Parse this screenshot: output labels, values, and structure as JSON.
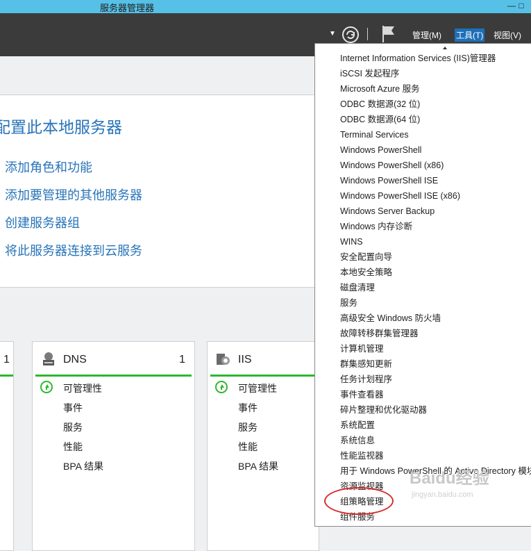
{
  "window": {
    "title": "服务器管理器",
    "minimize": "—",
    "maximize": "□"
  },
  "header": {
    "menus": {
      "manage": "管理(M)",
      "tools": "工具(T)",
      "view": "视图(V)"
    },
    "dropdown_arrow": "▼"
  },
  "quickstart": {
    "title": "配置此本地服务器",
    "links": [
      "添加角色和功能",
      "添加要管理的其他服务器",
      "创建服务器组",
      "将此服务器连接到云服务"
    ]
  },
  "tiles": {
    "left": {
      "count": "1"
    },
    "dns": {
      "name": "DNS",
      "count": "1",
      "rows": [
        "可管理性",
        "事件",
        "服务",
        "性能",
        "BPA 结果"
      ]
    },
    "iis": {
      "name": "IIS",
      "rows": [
        "可管理性",
        "事件",
        "服务",
        "性能",
        "BPA 结果"
      ]
    }
  },
  "tools_menu": {
    "items": [
      "Internet Information Services (IIS)管理器",
      "iSCSI 发起程序",
      "Microsoft Azure 服务",
      "ODBC 数据源(32 位)",
      "ODBC 数据源(64 位)",
      "Terminal Services",
      "Windows PowerShell",
      "Windows PowerShell (x86)",
      "Windows PowerShell ISE",
      "Windows PowerShell ISE (x86)",
      "Windows Server Backup",
      "Windows 内存诊断",
      "WINS",
      "安全配置向导",
      "本地安全策略",
      "磁盘清理",
      "服务",
      "高级安全 Windows 防火墙",
      "故障转移群集管理器",
      "计算机管理",
      "群集感知更新",
      "任务计划程序",
      "事件查看器",
      "碎片整理和优化驱动器",
      "系统配置",
      "系统信息",
      "性能监视器",
      "用于 Windows PowerShell 的 Active Directory 模块",
      "资源监视器",
      "组策略管理",
      "组件服务"
    ]
  },
  "watermark": {
    "brand": "Baidu经验",
    "url": "jingyan.baidu.com"
  },
  "colors": {
    "titlebar": "#57c0e6",
    "header": "#3b3b3b",
    "accent": "#2874b8",
    "status_ok": "#2eb82e",
    "highlight": "#d92b2b"
  }
}
